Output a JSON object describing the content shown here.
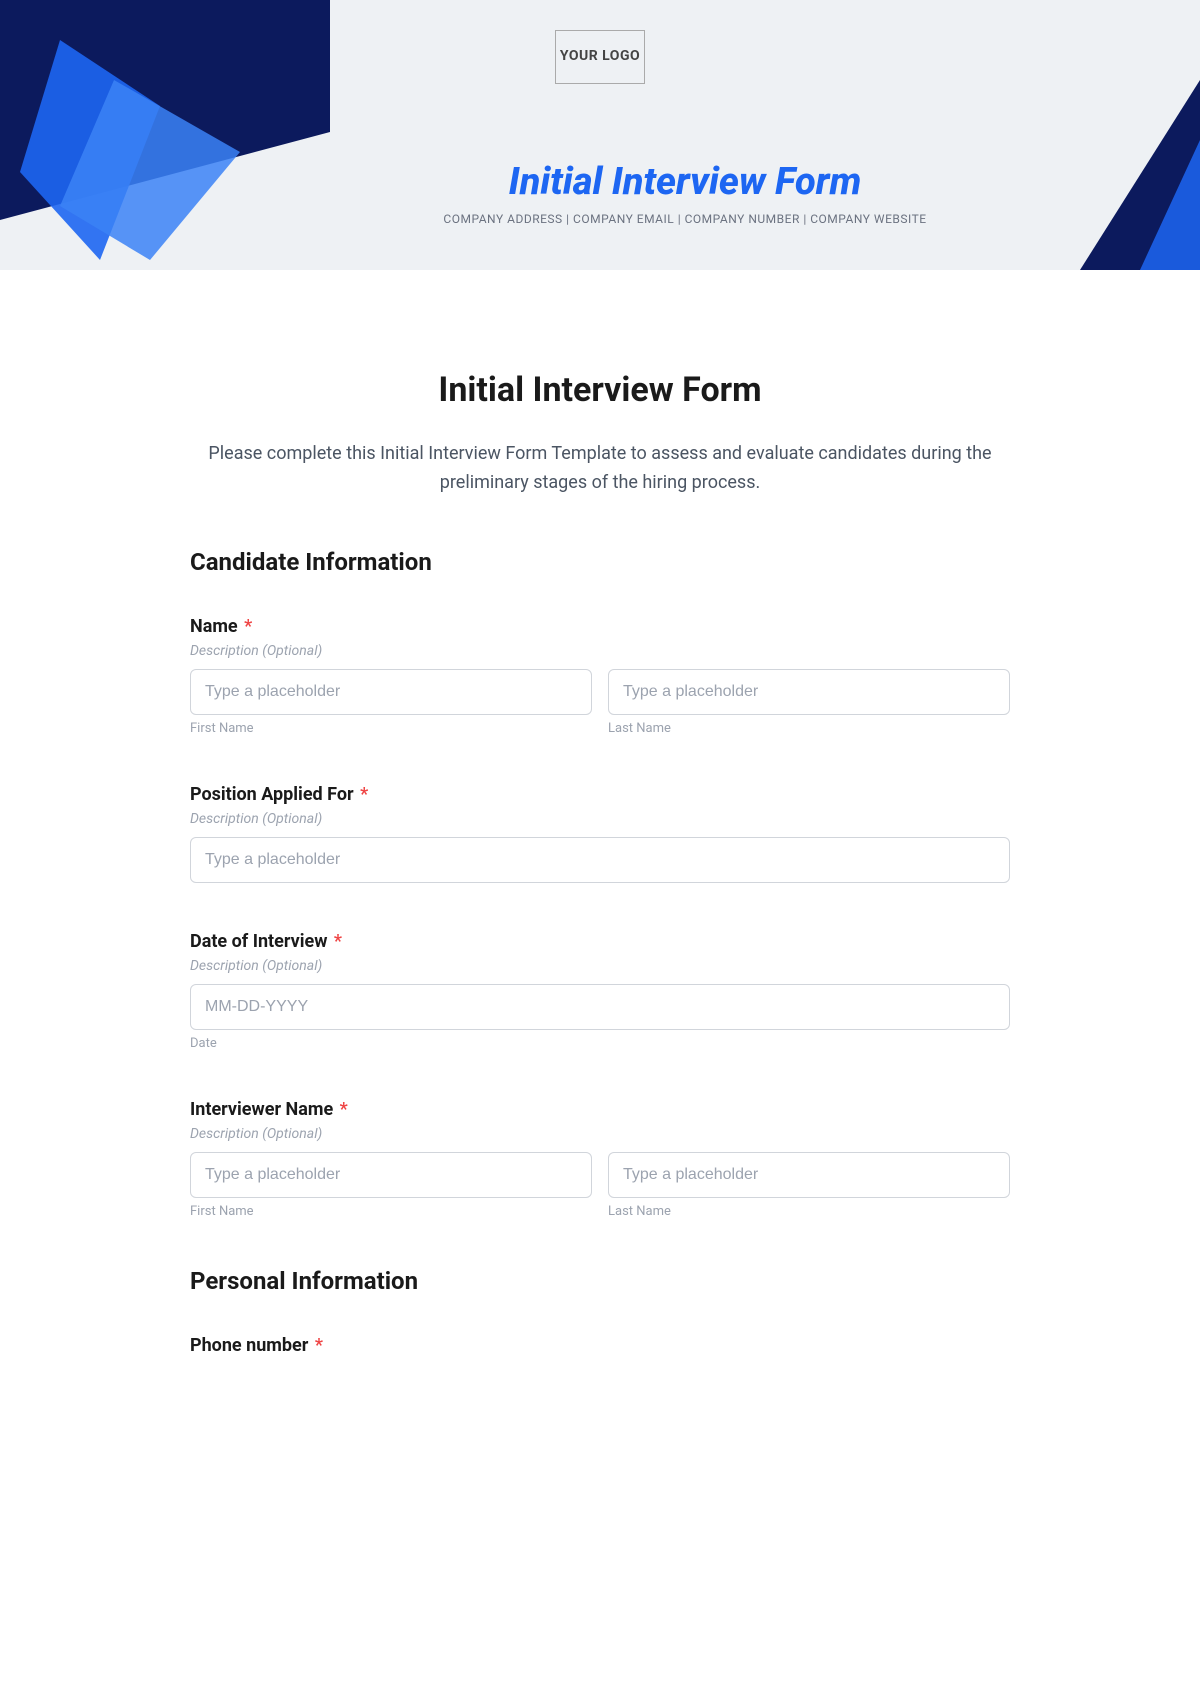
{
  "header": {
    "logo_text": "YOUR LOGO",
    "banner_title": "Initial Interview Form",
    "banner_meta": "COMPANY ADDRESS | COMPANY EMAIL | COMPANY NUMBER | COMPANY WEBSITE"
  },
  "form": {
    "title": "Initial Interview Form",
    "description": "Please complete this Initial Interview Form Template to assess and evaluate candidates during the preliminary stages of the hiring process.",
    "sections": {
      "candidate": "Candidate Information",
      "personal": "Personal Information"
    },
    "fields": {
      "name": {
        "label": "Name",
        "desc": "Description (Optional)",
        "first_placeholder": "Type a placeholder",
        "last_placeholder": "Type a placeholder",
        "first_sub": "First Name",
        "last_sub": "Last Name"
      },
      "position": {
        "label": "Position Applied For",
        "desc": "Description (Optional)",
        "placeholder": "Type a placeholder"
      },
      "date": {
        "label": "Date of Interview",
        "desc": "Description (Optional)",
        "placeholder": "MM-DD-YYYY",
        "sub": "Date"
      },
      "interviewer": {
        "label": "Interviewer Name",
        "desc": "Description (Optional)",
        "first_placeholder": "Type a placeholder",
        "last_placeholder": "Type a placeholder",
        "first_sub": "First Name",
        "last_sub": "Last Name"
      },
      "phone": {
        "label": "Phone number"
      }
    },
    "required_mark": "*"
  }
}
